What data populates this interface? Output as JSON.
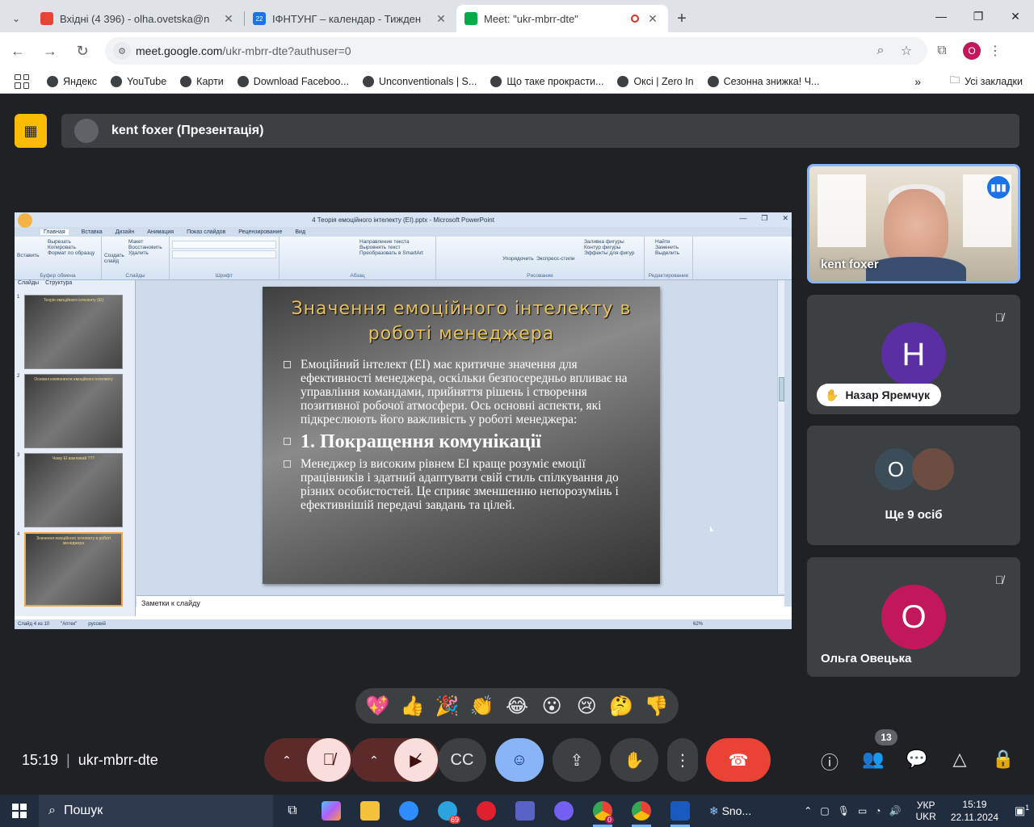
{
  "browser": {
    "tabs": [
      {
        "title": "Вхідні (4 396) - olha.ovetska@n",
        "favicon_color": "#ea4335",
        "active": false
      },
      {
        "title": "ІФНТУНГ – календар - Тижден",
        "favicon_color": "#1a73e8",
        "favicon_text": "22",
        "active": false
      },
      {
        "title": "Meet: \"ukr-mbrr-dte\"",
        "favicon_color": "#00ac47",
        "active": true
      }
    ],
    "address": {
      "domain": "meet.google.com",
      "path": "/ukr-mbrr-dte?authuser=0"
    },
    "profile_initial": "O",
    "bookmarks": [
      "Яндекс",
      "YouTube",
      "Карти",
      "Download Faceboo...",
      "Unconventionals | S...",
      "Що таке прокрасти...",
      "Oксі | Zero In",
      "Сезонна знижка! Ч..."
    ],
    "all_bookmarks": "Усі закладки"
  },
  "meet": {
    "presenter_bar": "kent foxer (Презентація)",
    "shared_screen": {
      "ppt_window_title": "4 Теорія емоційного інтелекту (EI).pptx - Microsoft PowerPoint",
      "ribbon_tabs": [
        "Главная",
        "Вставка",
        "Дизайн",
        "Анимация",
        "Показ слайдов",
        "Рецензирование",
        "Вид"
      ],
      "ribbon_groups": [
        "Буфер обмена",
        "Слайды",
        "Шрифт",
        "Абзац",
        "Рисование",
        "Редактирование"
      ],
      "ribbon_items": [
        "Вставить",
        "Вырезать",
        "Копировать",
        "Формат по образцу",
        "Создать слайд",
        "Макет",
        "Восстановить",
        "Удалить",
        "Направление текста",
        "Выровнять текст",
        "Преобразовать в SmartArt",
        "Упорядочить",
        "Экспресс-стили",
        "Заливка фигуры",
        "Контур фигуры",
        "Эффекты для фигур",
        "Найти",
        "Заменить",
        "Выделить"
      ],
      "pane_tabs": [
        "Слайды",
        "Структура"
      ],
      "thumbnails": [
        {
          "num": "1",
          "title": "Теорія емоційного інтелекту (EI)"
        },
        {
          "num": "2",
          "title": "Основні компоненти емоційного інтелекту"
        },
        {
          "num": "3",
          "title": "Чому EI важливий ???"
        },
        {
          "num": "4",
          "title": "Значення емоційного інтелекту в роботі менеджера"
        }
      ],
      "slide": {
        "title": "Значення  емоційного інтелекту в роботі менеджера",
        "paragraph1": "Емоційний інтелект (EI) має критичне значення для ефективності менеджера, оскільки безпосередньо впливає на управління командами, прийняття рішень і створення позитивної робочої атмосфери. Ось основні аспекти, які підкреслюють його важливість у роботі менеджера:",
        "heading": "1. Покращення комунікації",
        "paragraph2": "Менеджер із високим рівнем EI краще розуміє емоції працівників і здатний адаптувати свій стиль спілкування до різних особистостей. Це сприяє зменшенню непорозумінь і ефективнішій передачі завдань та цілей."
      },
      "notes_placeholder": "Заметки к слайду",
      "status": [
        "Слайд 4 из 10",
        "\"Аптек\"",
        "русский"
      ],
      "zoom": "62%"
    },
    "participants": [
      {
        "name": "kent foxer",
        "type": "video",
        "speaking": true
      },
      {
        "name": "Назар Яремчук",
        "initial": "H",
        "color": "#5b2fa3",
        "muted": true,
        "hand_raised": true
      },
      {
        "name": "Ще 9 осіб",
        "initial": "O",
        "color": "#3c4d5a",
        "group": true
      },
      {
        "name": "Ольга Овецька",
        "initial": "O",
        "color": "#c2185b",
        "muted": true
      }
    ],
    "reactions": [
      "💖",
      "👍",
      "🎉",
      "👏",
      "😂",
      "😮",
      "😢",
      "🤔",
      "👎"
    ],
    "time": "15:19",
    "meeting_code": "ukr-mbrr-dte",
    "participant_count": "13"
  },
  "taskbar": {
    "search_placeholder": "Пошук",
    "telegram_badge": "69",
    "chrome_badge": "0",
    "snow_label": "Sno...",
    "lang": [
      "УКР",
      "UKR"
    ],
    "time": "15:19",
    "date": "22.11.2024",
    "notification_count": "1"
  }
}
